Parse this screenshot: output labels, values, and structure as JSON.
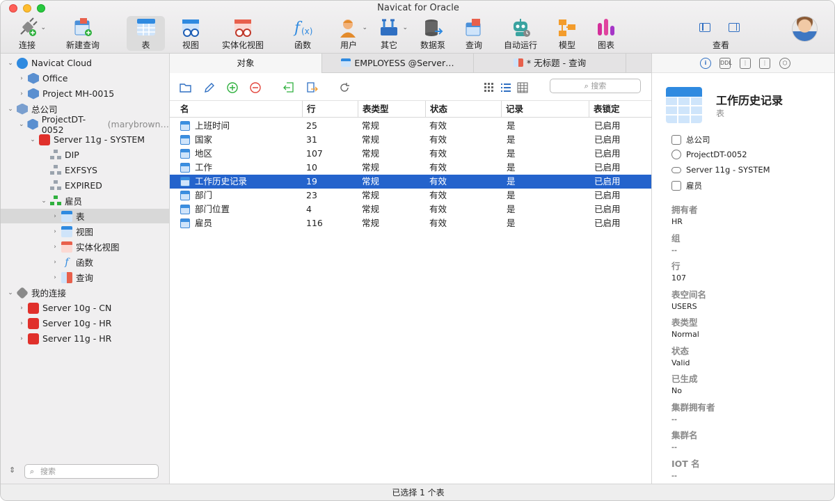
{
  "window": {
    "title": "Navicat for Oracle"
  },
  "toolbar": {
    "items": [
      {
        "label": "连接",
        "icon": "plug-connect-icon"
      },
      {
        "label": "新建查询",
        "icon": "new-query-icon"
      },
      {
        "label": "表",
        "icon": "table-icon",
        "active": true
      },
      {
        "label": "视图",
        "icon": "view-icon"
      },
      {
        "label": "实体化视图",
        "icon": "materialized-view-icon"
      },
      {
        "label": "函数",
        "icon": "function-icon"
      },
      {
        "label": "用户",
        "icon": "user-icon"
      },
      {
        "label": "其它",
        "icon": "tools-icon"
      },
      {
        "label": "数据泵",
        "icon": "data-pump-icon"
      },
      {
        "label": "查询",
        "icon": "query-icon"
      },
      {
        "label": "自动运行",
        "icon": "robot-icon"
      },
      {
        "label": "模型",
        "icon": "model-icon"
      },
      {
        "label": "图表",
        "icon": "chart-icon"
      }
    ],
    "view_label": "查看"
  },
  "sidebar": {
    "tree": [
      {
        "label": "Navicat Cloud",
        "level": 0,
        "arrow": "down",
        "icon": "cloud-icon"
      },
      {
        "label": "Office",
        "level": 1,
        "arrow": "right",
        "icon": "project-icon"
      },
      {
        "label": "Project MH-0015",
        "level": 1,
        "arrow": "right",
        "icon": "project-icon"
      },
      {
        "label": "总公司",
        "level": 0,
        "arrow": "down",
        "icon": "company-icon"
      },
      {
        "label": "ProjectDT-0052",
        "extra": "(marybrown…",
        "level": 1,
        "arrow": "down",
        "icon": "project-icon"
      },
      {
        "label": "Server 11g - SYSTEM",
        "level": 2,
        "arrow": "down",
        "icon": "oracle-server-icon"
      },
      {
        "label": "DIP",
        "level": 3,
        "arrow": "",
        "icon": "schema-icon"
      },
      {
        "label": "EXFSYS",
        "level": 3,
        "arrow": "",
        "icon": "schema-icon"
      },
      {
        "label": "EXPIRED",
        "level": 3,
        "arrow": "",
        "icon": "schema-icon"
      },
      {
        "label": "雇员",
        "level": 3,
        "arrow": "down",
        "icon": "schema-active-icon"
      },
      {
        "label": "表",
        "level": 4,
        "arrow": "right",
        "icon": "table-icon",
        "selected": true
      },
      {
        "label": "视图",
        "level": 4,
        "arrow": "right",
        "icon": "view-icon"
      },
      {
        "label": "实体化视图",
        "level": 4,
        "arrow": "right",
        "icon": "materialized-view-icon"
      },
      {
        "label": "函数",
        "level": 4,
        "arrow": "right",
        "icon": "function-icon"
      },
      {
        "label": "查询",
        "level": 4,
        "arrow": "right",
        "icon": "query-icon"
      },
      {
        "label": "我的连接",
        "level": 0,
        "arrow": "down",
        "icon": "plug-connect-icon"
      },
      {
        "label": "Server 10g - CN",
        "level": 1,
        "arrow": "right",
        "icon": "oracle-server-icon"
      },
      {
        "label": "Server 10g - HR",
        "level": 1,
        "arrow": "right",
        "icon": "oracle-server-icon"
      },
      {
        "label": "Server 11g - HR",
        "level": 1,
        "arrow": "right",
        "icon": "oracle-server-icon"
      }
    ],
    "search_placeholder": "搜索"
  },
  "tabs": [
    {
      "label": "对象",
      "active": true
    },
    {
      "label": "EMPLOYESS @Server…",
      "icon": "table-icon"
    },
    {
      "label": "* 无标题 - 查询",
      "icon": "query-icon"
    }
  ],
  "object_toolbar": {
    "search_placeholder": "搜索"
  },
  "table": {
    "headers": [
      "名",
      "行",
      "表类型",
      "状态",
      "记录",
      "表锁定"
    ],
    "rows": [
      {
        "name": "上班时间",
        "rows": "25",
        "type": "常规",
        "status": "有效",
        "logging": "是",
        "lock": "已启用"
      },
      {
        "name": "国家",
        "rows": "31",
        "type": "常规",
        "status": "有效",
        "logging": "是",
        "lock": "已启用"
      },
      {
        "name": "地区",
        "rows": "107",
        "type": "常规",
        "status": "有效",
        "logging": "是",
        "lock": "已启用"
      },
      {
        "name": "工作",
        "rows": "10",
        "type": "常规",
        "status": "有效",
        "logging": "是",
        "lock": "已启用"
      },
      {
        "name": "工作历史记录",
        "rows": "19",
        "type": "常规",
        "status": "有效",
        "logging": "是",
        "lock": "已启用",
        "selected": true
      },
      {
        "name": "部门",
        "rows": "23",
        "type": "常规",
        "status": "有效",
        "logging": "是",
        "lock": "已启用"
      },
      {
        "name": "部门位置",
        "rows": "4",
        "type": "常规",
        "status": "有效",
        "logging": "是",
        "lock": "已启用"
      },
      {
        "name": "雇员",
        "rows": "116",
        "type": "常规",
        "status": "有效",
        "logging": "是",
        "lock": "已启用"
      }
    ]
  },
  "info_panel": {
    "title": "工作历史记录",
    "subtitle": "表",
    "crumbs": [
      "总公司",
      "ProjectDT-0052",
      "Server 11g - SYSTEM",
      "雇员"
    ],
    "properties": [
      {
        "label": "拥有者",
        "value": "HR"
      },
      {
        "label": "组",
        "value": "--"
      },
      {
        "label": "行",
        "value": "107"
      },
      {
        "label": "表空间名",
        "value": "USERS"
      },
      {
        "label": "表类型",
        "value": "Normal"
      },
      {
        "label": "状态",
        "value": "Valid"
      },
      {
        "label": "已生成",
        "value": "No"
      },
      {
        "label": "集群拥有者",
        "value": "--"
      },
      {
        "label": "集群名",
        "value": "--"
      },
      {
        "label": "IOT 名",
        "value": "--"
      }
    ]
  },
  "status": {
    "text": "已选择 1 个表"
  }
}
